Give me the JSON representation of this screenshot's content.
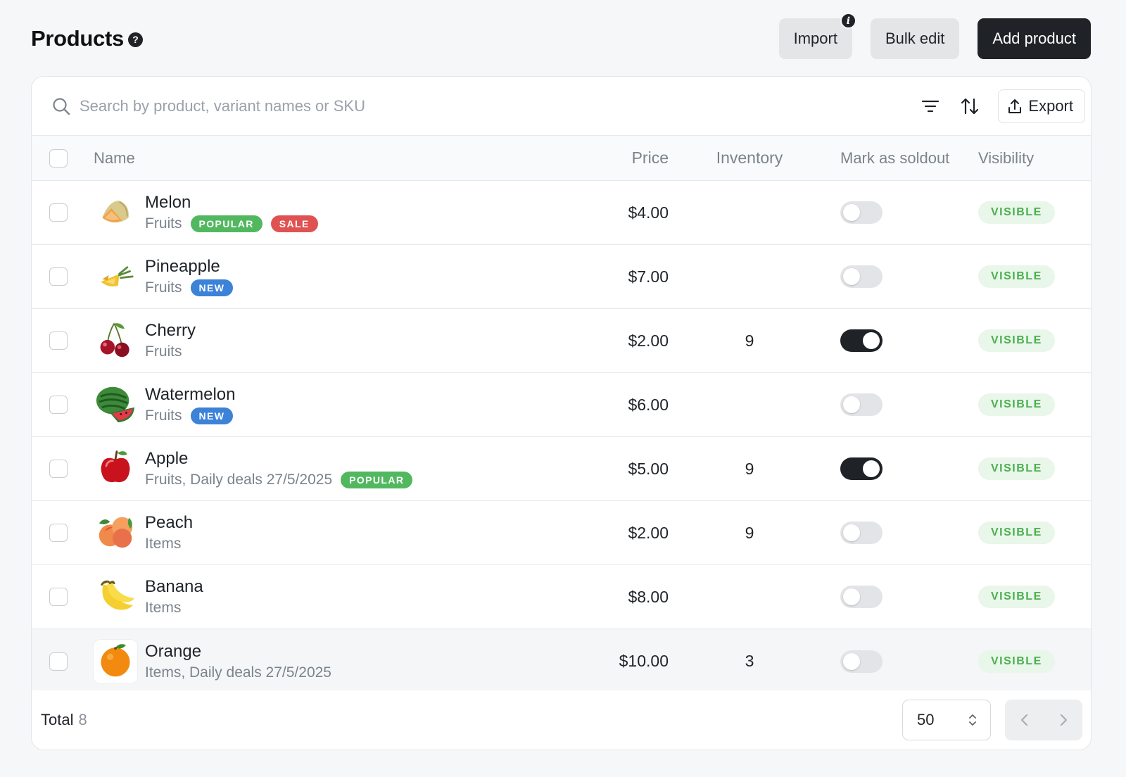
{
  "header": {
    "title": "Products",
    "import_label": "Import",
    "bulk_edit_label": "Bulk edit",
    "add_product_label": "Add product",
    "info_glyph": "i",
    "help_glyph": "?"
  },
  "toolbar": {
    "search_placeholder": "Search by product, variant names or SKU",
    "search_value": "",
    "export_label": "Export"
  },
  "columns": {
    "name": "Name",
    "price": "Price",
    "inventory": "Inventory",
    "mark_soldout": "Mark as soldout",
    "visibility": "Visibility"
  },
  "products": [
    {
      "name": "Melon",
      "category": "Fruits",
      "tags": [
        "POPULAR",
        "SALE"
      ],
      "price": "$4.00",
      "inventory": "",
      "soldout": false,
      "visibility": "VISIBLE",
      "icon": "melon-icon"
    },
    {
      "name": "Pineapple",
      "category": "Fruits",
      "tags": [
        "NEW"
      ],
      "price": "$7.00",
      "inventory": "",
      "soldout": false,
      "visibility": "VISIBLE",
      "icon": "pineapple-icon"
    },
    {
      "name": "Cherry",
      "category": "Fruits",
      "tags": [],
      "price": "$2.00",
      "inventory": "9",
      "soldout": true,
      "visibility": "VISIBLE",
      "icon": "cherry-icon"
    },
    {
      "name": "Watermelon",
      "category": "Fruits",
      "tags": [
        "NEW"
      ],
      "price": "$6.00",
      "inventory": "",
      "soldout": false,
      "visibility": "VISIBLE",
      "icon": "watermelon-icon"
    },
    {
      "name": "Apple",
      "category": "Fruits, Daily deals 27/5/2025",
      "tags": [
        "POPULAR"
      ],
      "price": "$5.00",
      "inventory": "9",
      "soldout": true,
      "visibility": "VISIBLE",
      "icon": "apple-icon"
    },
    {
      "name": "Peach",
      "category": "Items",
      "tags": [],
      "price": "$2.00",
      "inventory": "9",
      "soldout": false,
      "visibility": "VISIBLE",
      "icon": "peach-icon"
    },
    {
      "name": "Banana",
      "category": "Items",
      "tags": [],
      "price": "$8.00",
      "inventory": "",
      "soldout": false,
      "visibility": "VISIBLE",
      "icon": "banana-icon"
    },
    {
      "name": "Orange",
      "category": "Items, Daily deals 27/5/2025",
      "tags": [],
      "price": "$10.00",
      "inventory": "3",
      "soldout": false,
      "visibility": "VISIBLE",
      "icon": "orange-icon"
    }
  ],
  "footer": {
    "total_label": "Total",
    "total_count": "8",
    "page_size": "50"
  },
  "colors": {
    "accent_dark": "#1f2328",
    "popular": "#52b860",
    "sale": "#e05252",
    "new": "#3b82d8",
    "visible_text": "#4caf50",
    "visible_bg": "#e9f6ea"
  }
}
